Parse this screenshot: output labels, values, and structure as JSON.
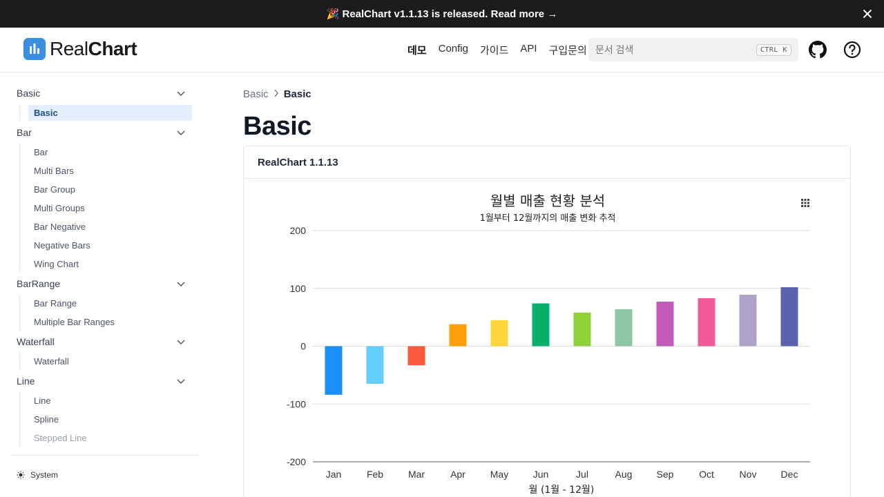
{
  "announcement": {
    "text": "🎉 RealChart v1.1.13 is released. Read more →",
    "close_icon": "close-icon"
  },
  "header": {
    "logo": {
      "text_regular": "Real",
      "text_bold": "Chart",
      "icon": "chart-logo-icon",
      "color": "#3b8fe0"
    },
    "nav": [
      {
        "label": "데모",
        "active": true
      },
      {
        "label": "Config",
        "active": false
      },
      {
        "label": "가이드",
        "active": false
      },
      {
        "label": "API",
        "active": false
      },
      {
        "label": "구입문의",
        "active": false
      }
    ],
    "search": {
      "placeholder": "문서 검색",
      "shortcut": "CTRL K"
    },
    "github_icon": "github-icon",
    "help_icon": "help-circle-icon"
  },
  "sidebar": {
    "sections": [
      {
        "title": "Basic",
        "items": [
          {
            "label": "Basic",
            "active": true
          }
        ]
      },
      {
        "title": "Bar",
        "items": [
          {
            "label": "Bar"
          },
          {
            "label": "Multi Bars"
          },
          {
            "label": "Bar Group"
          },
          {
            "label": "Multi Groups"
          },
          {
            "label": "Bar Negative"
          },
          {
            "label": "Negative Bars"
          },
          {
            "label": "Wing Chart"
          }
        ]
      },
      {
        "title": "BarRange",
        "items": [
          {
            "label": "Bar Range"
          },
          {
            "label": "Multiple Bar Ranges"
          }
        ]
      },
      {
        "title": "Waterfall",
        "items": [
          {
            "label": "Waterfall"
          }
        ]
      },
      {
        "title": "Line",
        "items": [
          {
            "label": "Line"
          },
          {
            "label": "Spline"
          },
          {
            "label": "Stepped Line"
          }
        ]
      }
    ],
    "theme_label": "System",
    "theme_icon": "sun-icon"
  },
  "main": {
    "breadcrumb": [
      "Basic",
      "Basic"
    ],
    "title": "Basic",
    "card_title": "RealChart 1.1.13",
    "chart_menu_icon": "grid-menu-icon"
  },
  "chart_data": {
    "type": "bar",
    "title": "월별 매출 현황 분석",
    "subtitle": "1월부터 12월까지의 매출 변화 추적",
    "xlabel": "월 (1월 - 12월)",
    "ylabel": "",
    "categories": [
      "Jan",
      "Feb",
      "Mar",
      "Apr",
      "May",
      "Jun",
      "Jul",
      "Aug",
      "Sep",
      "Oct",
      "Nov",
      "Dec"
    ],
    "values": [
      -84,
      -65,
      -33,
      38,
      45,
      74,
      58,
      64,
      77,
      83,
      89,
      102
    ],
    "colors": [
      "#1a8ff5",
      "#63cdfb",
      "#fb5a3b",
      "#ff9f0a",
      "#ffd63b",
      "#06b06a",
      "#8fd13b",
      "#8ec6a6",
      "#c45ab9",
      "#f05a98",
      "#afa3c9",
      "#5b63ae"
    ],
    "ylim": [
      -200,
      200
    ],
    "yticks": [
      200,
      100,
      0,
      -100,
      -200
    ],
    "grid": true,
    "legend": "none"
  }
}
